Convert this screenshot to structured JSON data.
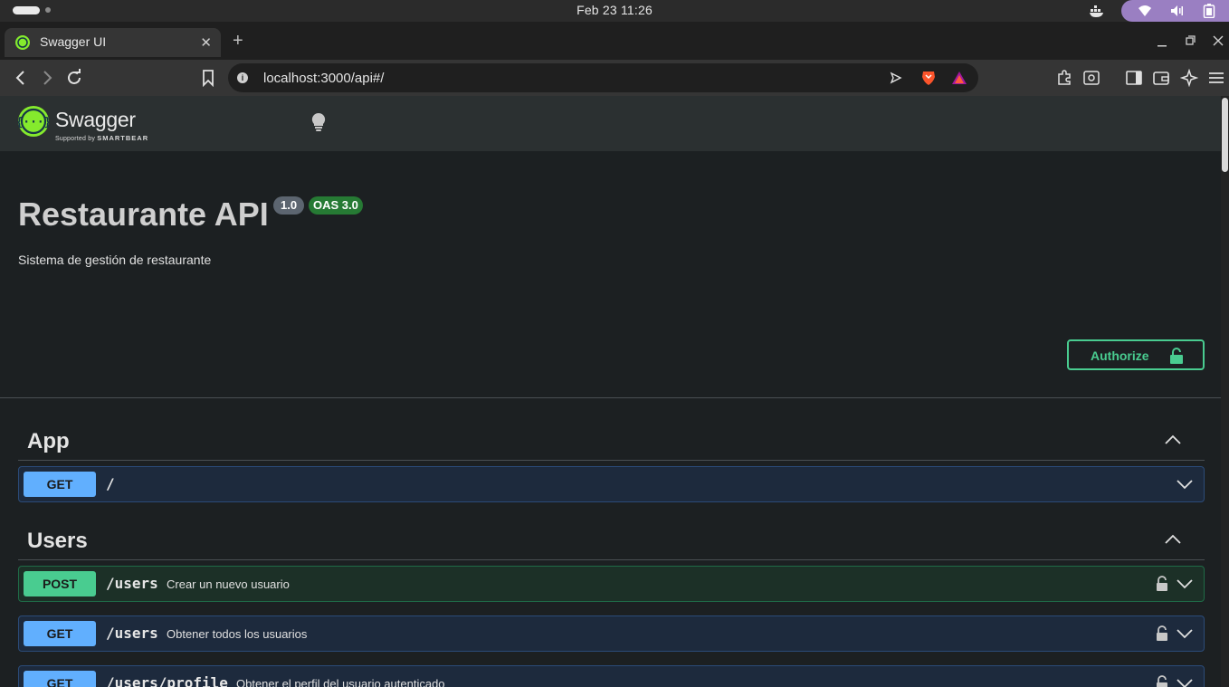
{
  "os": {
    "clock": "Feb 23  11:26"
  },
  "browser": {
    "tab_title": "Swagger UI",
    "tab_close": "✕",
    "new_tab": "+",
    "url": "localhost:3000/api#/"
  },
  "swagger": {
    "brand": "Swagger",
    "brand_sub_prefix": "Supported by",
    "brand_sub": "SMARTBEAR"
  },
  "api": {
    "title": "Restaurante API",
    "version": "1.0",
    "oas": "OAS 3.0",
    "description": "Sistema de gestión de restaurante",
    "authorize_label": "Authorize"
  },
  "tags": [
    {
      "name": "App",
      "operations": [
        {
          "method": "GET",
          "path": "/",
          "summary": ""
        }
      ]
    },
    {
      "name": "Users",
      "operations": [
        {
          "method": "POST",
          "path": "/users",
          "summary": "Crear un nuevo usuario"
        },
        {
          "method": "GET",
          "path": "/users",
          "summary": "Obtener todos los usuarios"
        },
        {
          "method": "GET",
          "path": "/users/profile",
          "summary": "Obtener el perfil del usuario autenticado"
        }
      ]
    }
  ],
  "colors": {
    "get": "#61affe",
    "post": "#49cc90",
    "authorize": "#49cc90",
    "oas_badge": "#267a34"
  },
  "icons": [
    "wifi-icon",
    "volume-icon",
    "battery-icon",
    "docker-icon",
    "lock-icon",
    "chevron-down-icon",
    "chevron-up-icon",
    "bulb-icon"
  ]
}
